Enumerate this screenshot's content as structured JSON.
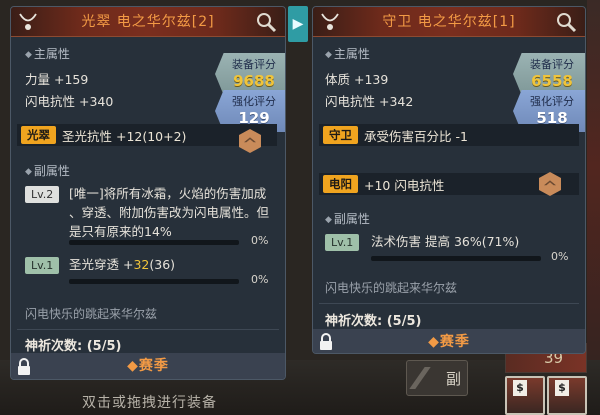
{
  "left": {
    "title": "光翠 电之华尔兹[2]",
    "main_attr_title": "主属性",
    "main_stats": [
      "力量 +159",
      "闪电抗性 +340"
    ],
    "score_label": "装备评分",
    "score_value": "9688",
    "enhance_label": "强化评分",
    "enhance_value": "129",
    "set_tag": "光翠",
    "set_text": "圣光抗性 +12(10+2)",
    "sub_attr_title": "副属性",
    "sub1_level": "Lv.2",
    "sub1_lines": [
      "[唯一]将所有冰霜，火焰的伤害加成",
      "、穿透、附加伤害改为闪电属性。但",
      "是只有原来的14%"
    ],
    "sub1_pct": "0%",
    "sub1_progress": 0,
    "sub2_level": "Lv.1",
    "sub2_prefix": "圣光穿透 +",
    "sub2_value": "32",
    "sub2_suffix": "(36)",
    "sub2_pct": "0%",
    "sub2_progress": 0,
    "flavor": "闪电快乐的跳起来华尔兹",
    "pray": "神祈次数: (5/5)",
    "season": "◆赛季"
  },
  "right": {
    "title": "守卫 电之华尔兹[1]",
    "main_attr_title": "主属性",
    "main_stats": [
      "体质 +139",
      "闪电抗性 +342"
    ],
    "score_label": "装备评分",
    "score_value": "6558",
    "enhance_label": "强化评分",
    "enhance_value": "518",
    "set_tag": "守卫",
    "set_text": "承受伤害百分比 -1",
    "set2_tag": "电阳",
    "set2_text": "+10 闪电抗性",
    "sub_attr_title": "副属性",
    "sub1_level": "Lv.1",
    "sub1_text": "法术伤害 提高 36%(71%)",
    "sub1_pct": "0%",
    "sub1_progress": 0,
    "flavor": "闪电快乐的跳起来华尔兹",
    "pray": "神祈次数: (5/5)",
    "season": "◆赛季"
  },
  "background": {
    "hint": "双击或拖拽进行装备",
    "button_label": "副",
    "slot_top_count": "39",
    "slot_badge": "$"
  },
  "colors": {
    "header_text": "#f29a45",
    "score_gold": "#f0c43a",
    "tag_orange": "#f0a41f",
    "panel_bg": "#27303a"
  },
  "icons": [
    "necklace-icon",
    "search-icon",
    "lock-icon",
    "chevron-right-icon",
    "rank-chevron-icon"
  ]
}
